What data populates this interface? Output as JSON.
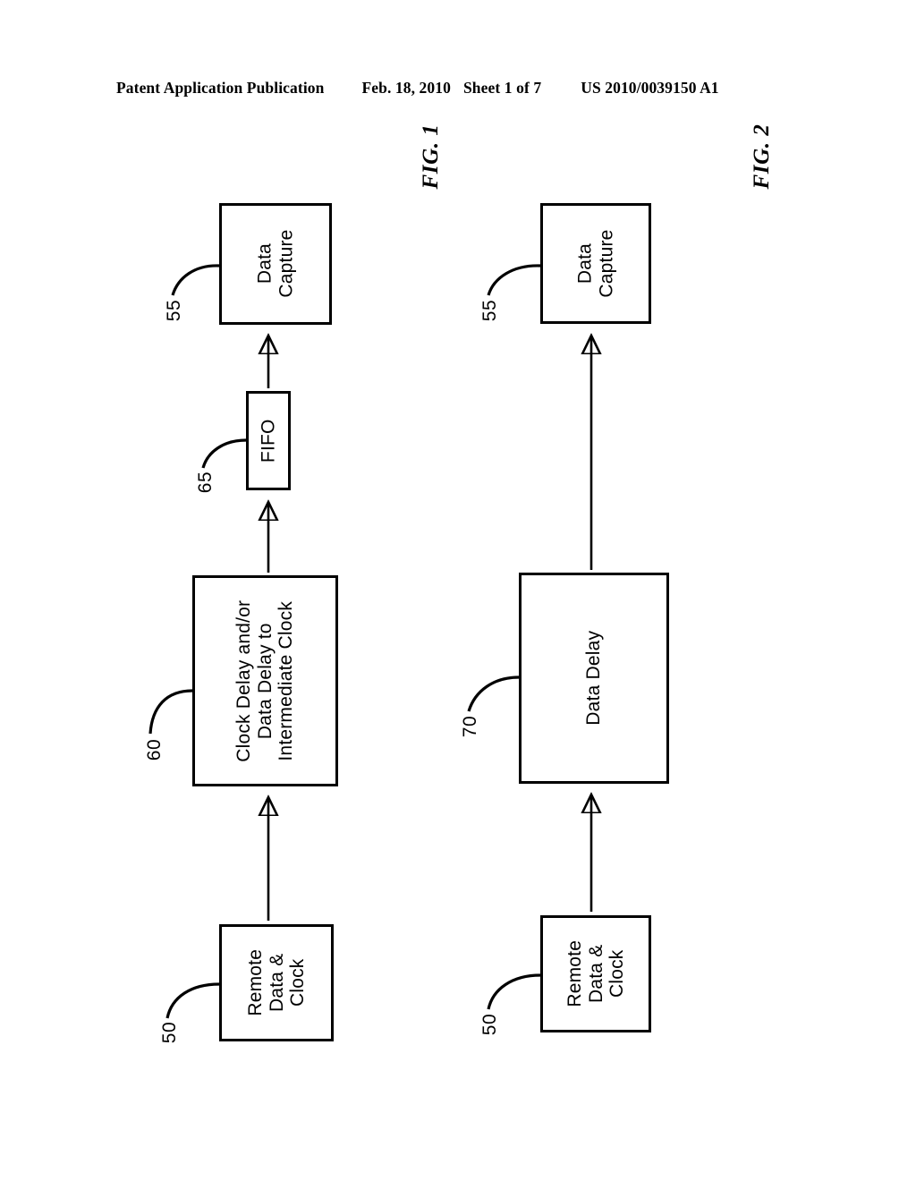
{
  "header": {
    "publication": "Patent Application Publication",
    "date": "Feb. 18, 2010",
    "sheet": "Sheet 1 of 7",
    "patent_number": "US 2010/0039150 A1"
  },
  "figures": [
    {
      "caption": "FIG. 1",
      "blocks": [
        {
          "id": "fig1-data-capture",
          "ref": "55",
          "lines": [
            "Data",
            "Capture"
          ]
        },
        {
          "id": "fig1-fifo",
          "ref": "65",
          "lines": [
            "FIFO"
          ]
        },
        {
          "id": "fig1-clock-delay",
          "ref": "60",
          "lines": [
            "Clock Delay and/or",
            "Data Delay to",
            "Intermediate Clock"
          ]
        },
        {
          "id": "fig1-remote",
          "ref": "50",
          "lines": [
            "Remote",
            "Data &",
            "Clock"
          ]
        }
      ]
    },
    {
      "caption": "FIG. 2",
      "blocks": [
        {
          "id": "fig2-data-capture",
          "ref": "55",
          "lines": [
            "Data",
            "Capture"
          ]
        },
        {
          "id": "fig2-data-delay",
          "ref": "70",
          "lines": [
            "Data Delay"
          ]
        },
        {
          "id": "fig2-remote",
          "ref": "50",
          "lines": [
            "Remote",
            "Data &",
            "Clock"
          ]
        }
      ]
    }
  ],
  "fig1": {
    "caption": "FIG. 1",
    "data_capture": {
      "ref": "55",
      "l1": "Data",
      "l2": "Capture"
    },
    "fifo": {
      "ref": "65",
      "l1": "FIFO"
    },
    "clock_delay": {
      "ref": "60",
      "l1": "Clock Delay and/or",
      "l2": "Data Delay to",
      "l3": "Intermediate Clock"
    },
    "remote": {
      "ref": "50",
      "l1": "Remote",
      "l2": "Data &",
      "l3": "Clock"
    }
  },
  "fig2": {
    "caption": "FIG. 2",
    "data_capture": {
      "ref": "55",
      "l1": "Data",
      "l2": "Capture"
    },
    "data_delay": {
      "ref": "70",
      "l1": "Data Delay"
    },
    "remote": {
      "ref": "50",
      "l1": "Remote",
      "l2": "Data &",
      "l3": "Clock"
    }
  },
  "colors": {
    "ink": "#000000",
    "page": "#ffffff"
  }
}
